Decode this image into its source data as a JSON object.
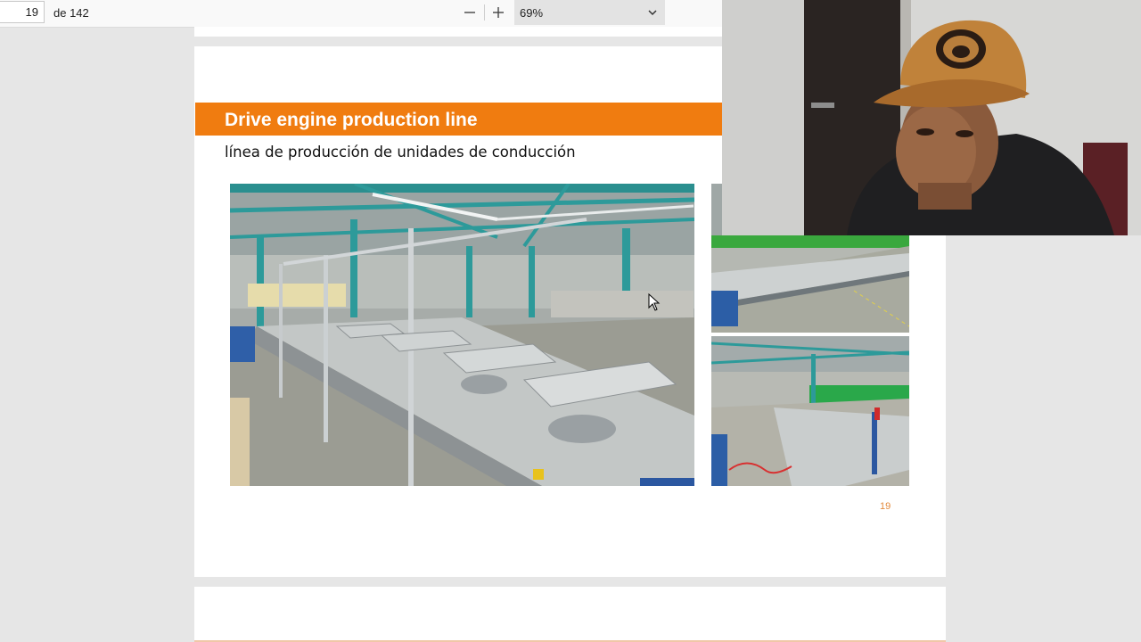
{
  "toolbar": {
    "page_current": "19",
    "page_total": "de 142",
    "zoom_out_icon": "minus-icon",
    "zoom_in_icon": "plus-icon",
    "zoom_value": "69%",
    "zoom_dropdown_icon": "chevron-down-icon"
  },
  "slide": {
    "title": "Drive engine production line",
    "subtitle": "línea de producción de unidades de conducción",
    "page_number": "19"
  },
  "colors": {
    "title_bar": "#f07c10",
    "page_number": "#e38a3c",
    "viewer_background": "#e6e6e6"
  }
}
